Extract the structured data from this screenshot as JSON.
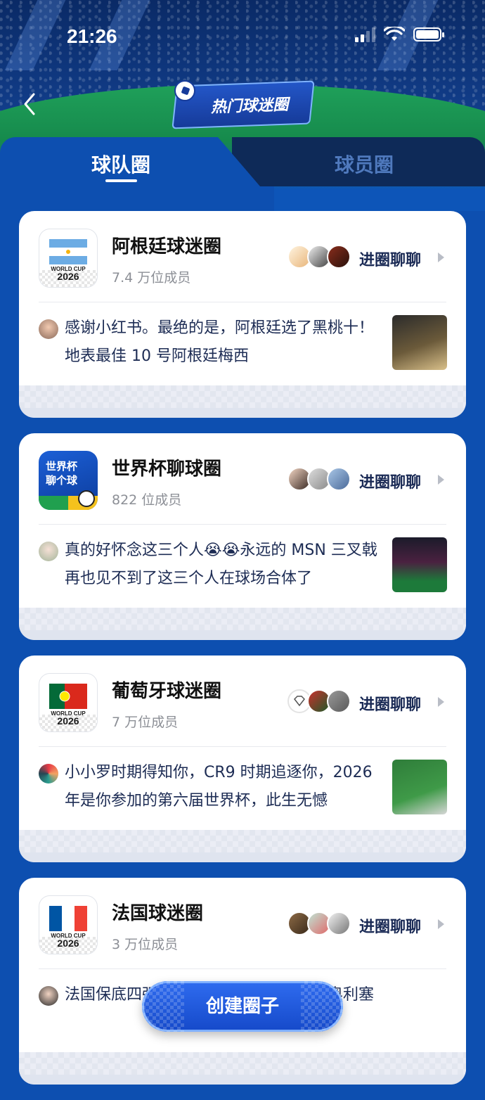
{
  "status_bar": {
    "time": "21:26"
  },
  "header": {
    "title": "热门球迷圈",
    "back_icon": "chevron-left-icon"
  },
  "tabs": [
    {
      "label": "球队圈",
      "active": true
    },
    {
      "label": "球员圈",
      "active": false
    }
  ],
  "circles": [
    {
      "name": "阿根廷球迷圈",
      "members": "7.4 万位成员",
      "action": "进圈聊聊",
      "logo_caption": [
        "WORLD CUP",
        "2026"
      ],
      "post": "感谢小红书。最绝的是，阿根廷选了黑桃十！地表最佳 10 号阿根廷梅西"
    },
    {
      "name": "世界杯聊球圈",
      "members": "822 位成员",
      "action": "进圈聊聊",
      "logo_text": [
        "世界杯",
        "聊个球"
      ],
      "post": "真的好怀念这三个人😭😭永远的 MSN 三叉戟再也见不到了这三个人在球场合体了"
    },
    {
      "name": "葡萄牙球迷圈",
      "members": "7 万位成员",
      "action": "进圈聊聊",
      "logo_caption": [
        "WORLD CUP",
        "2026"
      ],
      "post": "小小罗时期得知你，CR9 时期追逐你，2026 年是你参加的第六届世界杯，此生无憾"
    },
    {
      "name": "法国球迷圈",
      "members": "3 万位成员",
      "action": "进圈聊聊",
      "logo_caption": [
        "WORLD CUP",
        "2026"
      ],
      "post": "法国保底四强看后防和锋线的发挥了，奥利塞"
    }
  ],
  "create_button": {
    "label": "创建圈子"
  },
  "colors": {
    "primary_blue": "#0d4fb0",
    "button_blue": "#1f5be0",
    "card_text": "#1d2c54"
  }
}
